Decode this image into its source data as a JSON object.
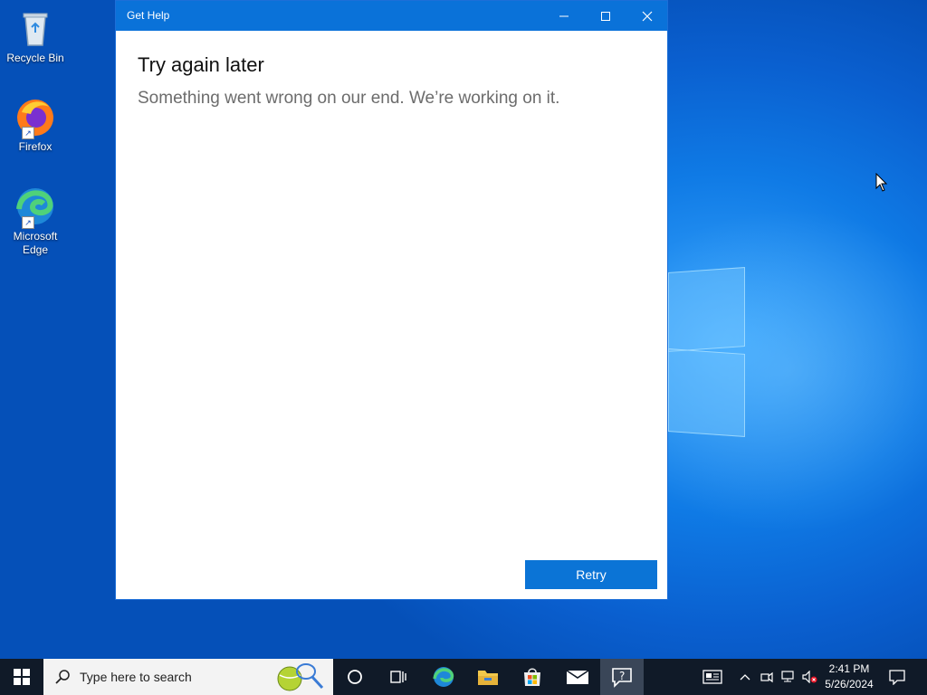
{
  "desktop": {
    "icons": [
      {
        "label": "Recycle Bin"
      },
      {
        "label": "Firefox"
      },
      {
        "label": "Microsoft Edge"
      }
    ]
  },
  "window": {
    "title": "Get Help",
    "heading": "Try again later",
    "message": "Something went wrong on our end. We’re working on it.",
    "retry_label": "Retry",
    "accent": "#0b74d6"
  },
  "taskbar": {
    "search_placeholder": "Type here to search",
    "time": "2:41 PM",
    "date": "5/26/2024",
    "apps": [
      "task-view",
      "edge",
      "file-explorer",
      "store",
      "mail",
      "get-help"
    ]
  }
}
